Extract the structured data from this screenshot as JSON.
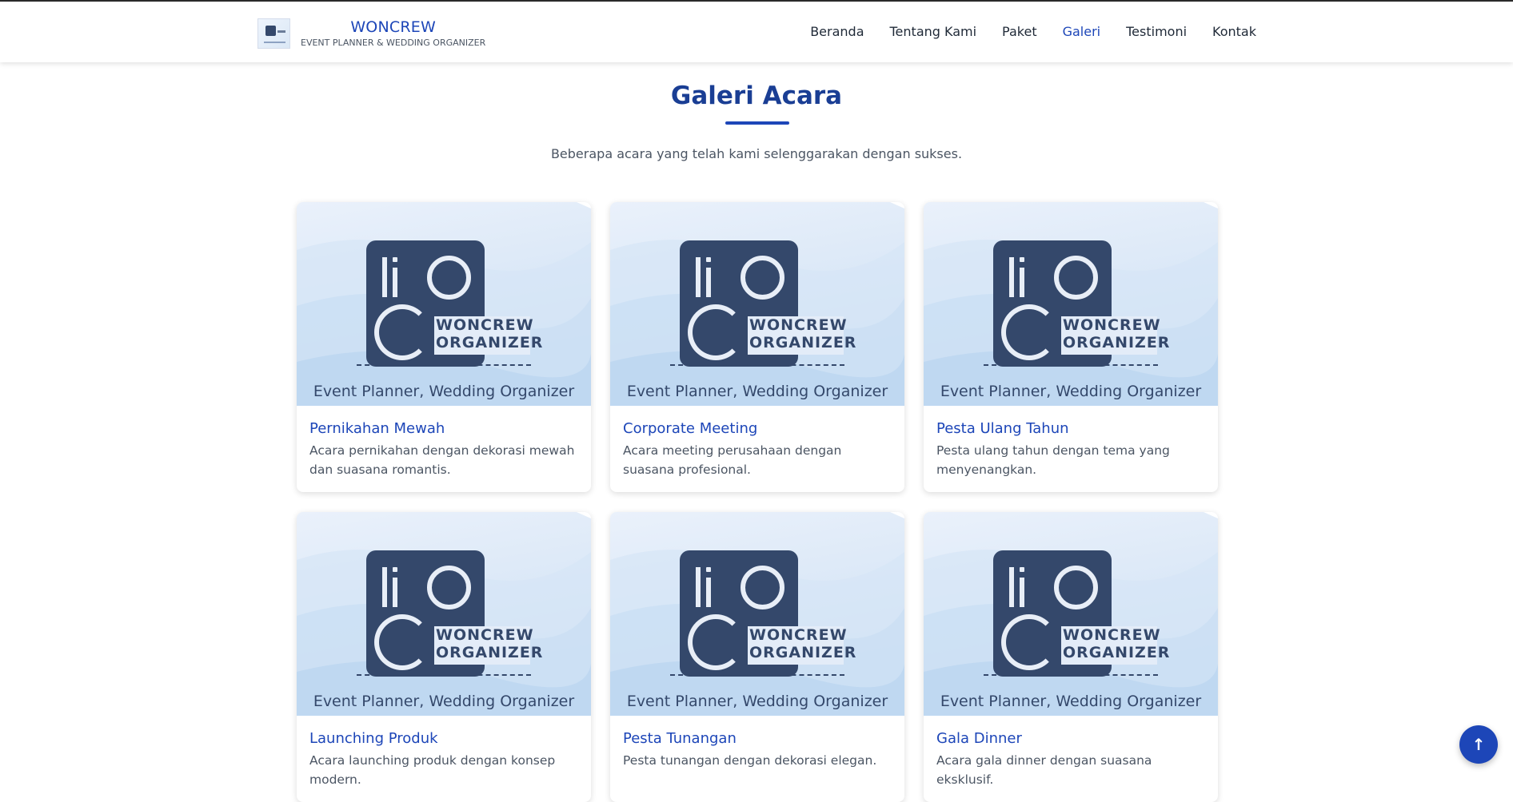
{
  "brand": {
    "title": "WONCREW",
    "subtitle": "EVENT PLANNER & WEDDING ORGANIZER",
    "logo_icon": "woncrew-logo"
  },
  "nav": [
    {
      "label": "Beranda",
      "active": false
    },
    {
      "label": "Tentang Kami",
      "active": false
    },
    {
      "label": "Paket",
      "active": false
    },
    {
      "label": "Galeri",
      "active": true
    },
    {
      "label": "Testimoni",
      "active": false
    },
    {
      "label": "Kontak",
      "active": false
    }
  ],
  "gallery": {
    "title": "Galeri Acara",
    "subtitle": "Beberapa acara yang telah kami selenggarakan dengan sukses.",
    "image_text": {
      "line1": "WONCREW",
      "line2": "ORGANIZER",
      "dashes": "--------------------",
      "tagline": "Event Planner, Wedding Organizer"
    },
    "items": [
      {
        "title": "Pernikahan Mewah",
        "desc": "Acara pernikahan dengan dekorasi mewah dan suasana romantis."
      },
      {
        "title": "Corporate Meeting",
        "desc": "Acara meeting perusahaan dengan suasana profesional."
      },
      {
        "title": "Pesta Ulang Tahun",
        "desc": "Pesta ulang tahun dengan tema yang menyenangkan."
      },
      {
        "title": "Launching Produk",
        "desc": "Acara launching produk dengan konsep modern."
      },
      {
        "title": "Pesta Tunangan",
        "desc": "Pesta tunangan dengan dekorasi elegan."
      },
      {
        "title": "Gala Dinner",
        "desc": "Acara gala dinner dengan suasana eksklusif."
      }
    ]
  },
  "scroll_top": {
    "icon": "arrow-up-icon",
    "glyph": "↑"
  },
  "colors": {
    "accent": "#1d46b8",
    "heading": "#1a3e94",
    "logo": "#34486b"
  }
}
